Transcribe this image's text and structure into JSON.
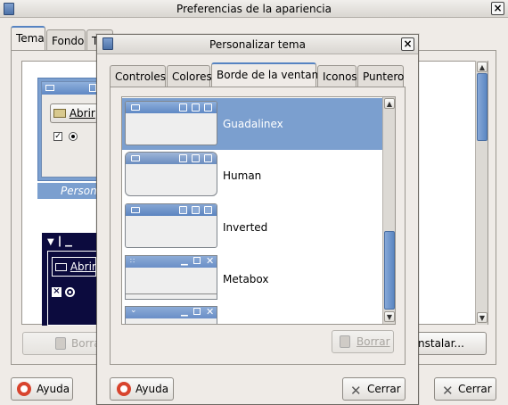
{
  "back_window": {
    "title": "Preferencias de la apariencia",
    "tabs": [
      "Tema",
      "Fondo",
      "Ti"
    ],
    "selected_theme_label": "Persona",
    "sample_open_label": "Abrir",
    "dark_sample_open_label": "Abrir",
    "remove_button": "Borra",
    "install_button": "nstalar...",
    "help_button": "Ayuda",
    "close_button": "Cerrar"
  },
  "dialog": {
    "title": "Personalizar tema",
    "tabs": [
      "Controles",
      "Colores",
      "Borde de la ventana",
      "Iconos",
      "Puntero"
    ],
    "active_tab": "Borde de la ventana",
    "items": [
      {
        "label": "Guadalinex",
        "selected": true
      },
      {
        "label": "Human",
        "selected": false
      },
      {
        "label": "Inverted",
        "selected": false
      },
      {
        "label": "Metabox",
        "selected": false
      },
      {
        "label": "",
        "selected": false
      }
    ],
    "remove_button": "Borrar",
    "help_button": "Ayuda",
    "close_button": "Cerrar"
  },
  "colors": {
    "selection": "#7b9fcf",
    "accent": "#5683c2",
    "dark_sample": "#0c0b3e"
  }
}
